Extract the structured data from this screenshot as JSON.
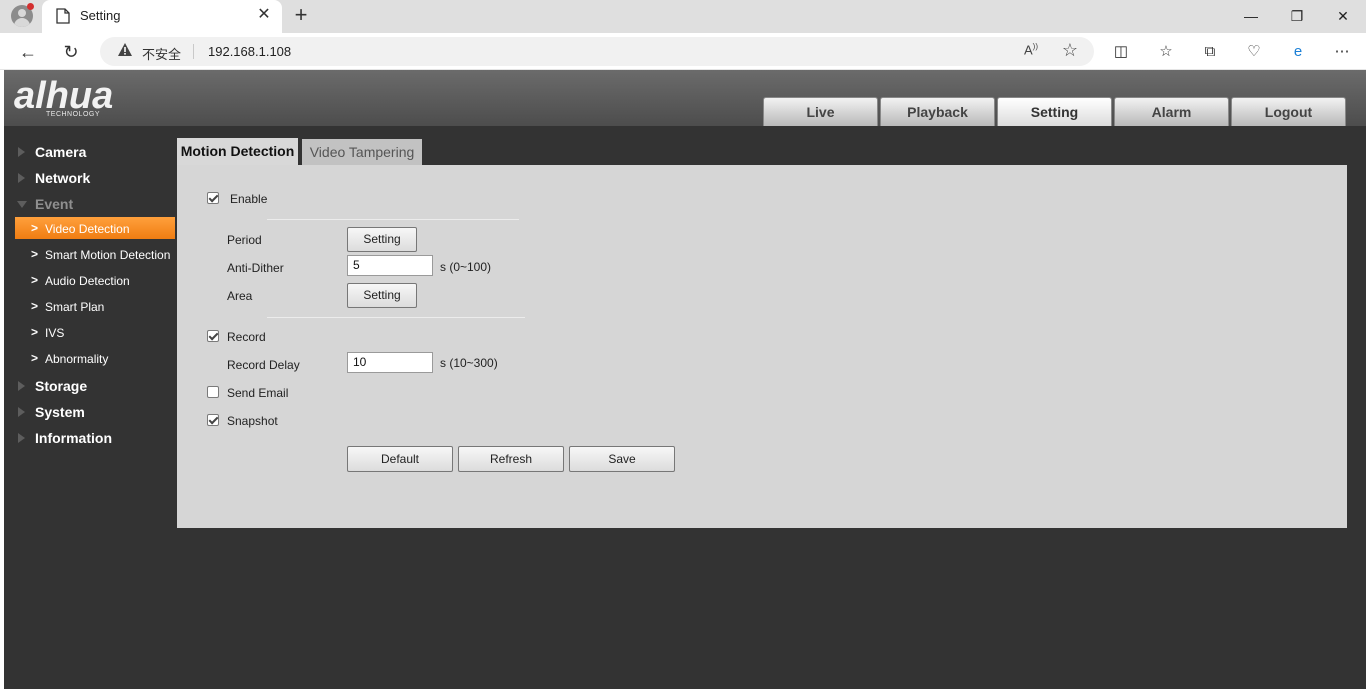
{
  "browser": {
    "tab_title": "Setting",
    "tab_close": "✕",
    "new_tab": "+",
    "insecure_label": "不安全",
    "url": "192.168.1.108",
    "window_controls": {
      "minimize": "—",
      "restore": "❐",
      "close": "✕"
    }
  },
  "app": {
    "logo": "alhua",
    "logo_sub": "TECHNOLOGY",
    "topnav": [
      "Live",
      "Playback",
      "Setting",
      "Alarm",
      "Logout"
    ],
    "active_topnav": "Setting"
  },
  "sidebar": {
    "sections": [
      {
        "label": "Camera"
      },
      {
        "label": "Network"
      },
      {
        "label": "Event"
      }
    ],
    "event_items": [
      {
        "label": "Video Detection",
        "active": true
      },
      {
        "label": "Smart Motion Detection"
      },
      {
        "label": "Audio Detection"
      },
      {
        "label": "Smart Plan"
      },
      {
        "label": "IVS"
      },
      {
        "label": "Abnormality"
      }
    ],
    "lower_sections": [
      {
        "label": "Storage"
      },
      {
        "label": "System"
      },
      {
        "label": "Information"
      }
    ]
  },
  "content": {
    "tabs": [
      "Motion Detection",
      "Video Tampering"
    ],
    "enable_label": "Enable",
    "period_label": "Period",
    "period_button": "Setting",
    "antidither_label": "Anti-Dither",
    "antidither_value": "5",
    "antidither_unit": "s (0~100)",
    "area_label": "Area",
    "area_button": "Setting",
    "record_label": "Record",
    "record_delay_label": "Record Delay",
    "record_delay_value": "10",
    "record_delay_unit": "s (10~300)",
    "send_email_label": "Send Email",
    "snapshot_label": "Snapshot",
    "buttons": {
      "default": "Default",
      "refresh": "Refresh",
      "save": "Save"
    },
    "checked": {
      "enable": true,
      "record": true,
      "send_email": false,
      "snapshot": true
    }
  }
}
